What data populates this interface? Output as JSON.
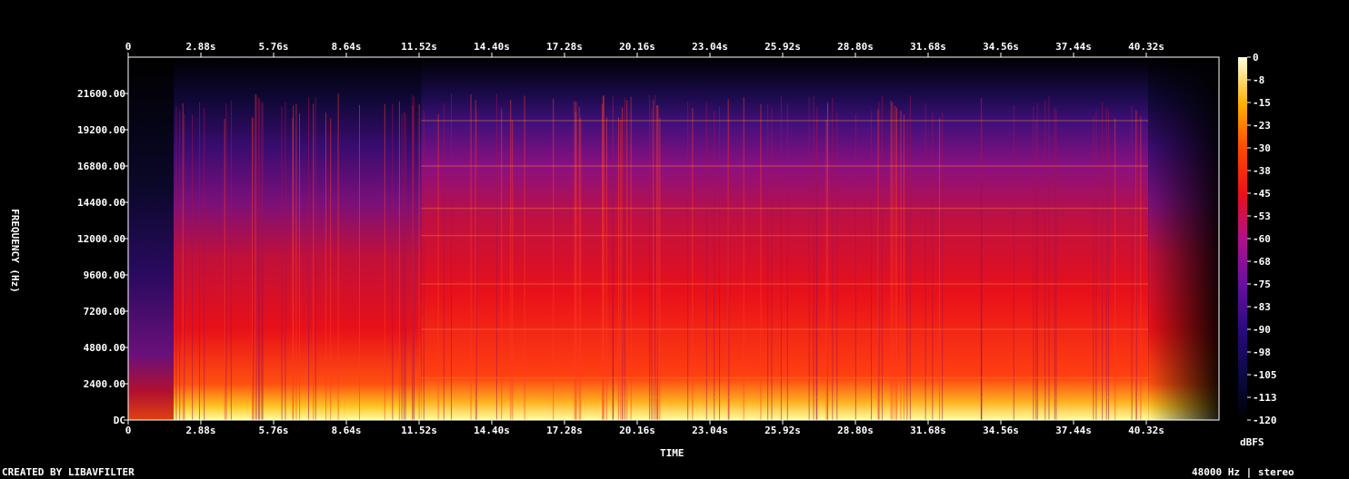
{
  "chart_data": {
    "type": "heatmap",
    "xlabel": "TIME",
    "ylabel": "FREQUENCY (Hz)",
    "x_ticks": [
      "0",
      "2.88s",
      "5.76s",
      "8.64s",
      "11.52s",
      "14.40s",
      "17.28s",
      "20.16s",
      "23.04s",
      "25.92s",
      "28.80s",
      "31.68s",
      "34.56s",
      "37.44s",
      "40.32s"
    ],
    "x_tick_values": [
      0,
      2.88,
      5.76,
      8.64,
      11.52,
      14.4,
      17.28,
      20.16,
      23.04,
      25.92,
      28.8,
      31.68,
      34.56,
      37.44,
      40.32
    ],
    "y_ticks": [
      "DC",
      "2400.00",
      "4800.00",
      "7200.00",
      "9600.00",
      "12000.00",
      "14400.00",
      "16800.00",
      "19200.00",
      "21600.00"
    ],
    "y_tick_values": [
      0,
      2400,
      4800,
      7200,
      9600,
      12000,
      14400,
      16800,
      19200,
      21600
    ],
    "xlim": [
      0,
      43.2
    ],
    "ylim": [
      0,
      24000
    ],
    "colorbar": {
      "unit": "dBFS",
      "ticks": [
        "0",
        "-8",
        "-15",
        "-23",
        "-30",
        "-38",
        "-45",
        "-53",
        "-60",
        "-68",
        "-75",
        "-83",
        "-90",
        "-98",
        "-105",
        "-113",
        "-120"
      ],
      "range": [
        -120,
        0
      ]
    },
    "regions": [
      {
        "t_start": 0.0,
        "t_end": 1.8,
        "level": "quiet"
      },
      {
        "t_start": 1.8,
        "t_end": 11.6,
        "level": "loud"
      },
      {
        "t_start": 11.6,
        "t_end": 40.4,
        "level": "loud-tonal"
      },
      {
        "t_start": 40.4,
        "t_end": 43.2,
        "level": "decay"
      }
    ]
  },
  "footer": {
    "left": "CREATED BY LIBAVFILTER",
    "right": "48000 Hz | stereo"
  },
  "colors": {
    "background": "#000000",
    "axis": "#ffffff"
  }
}
